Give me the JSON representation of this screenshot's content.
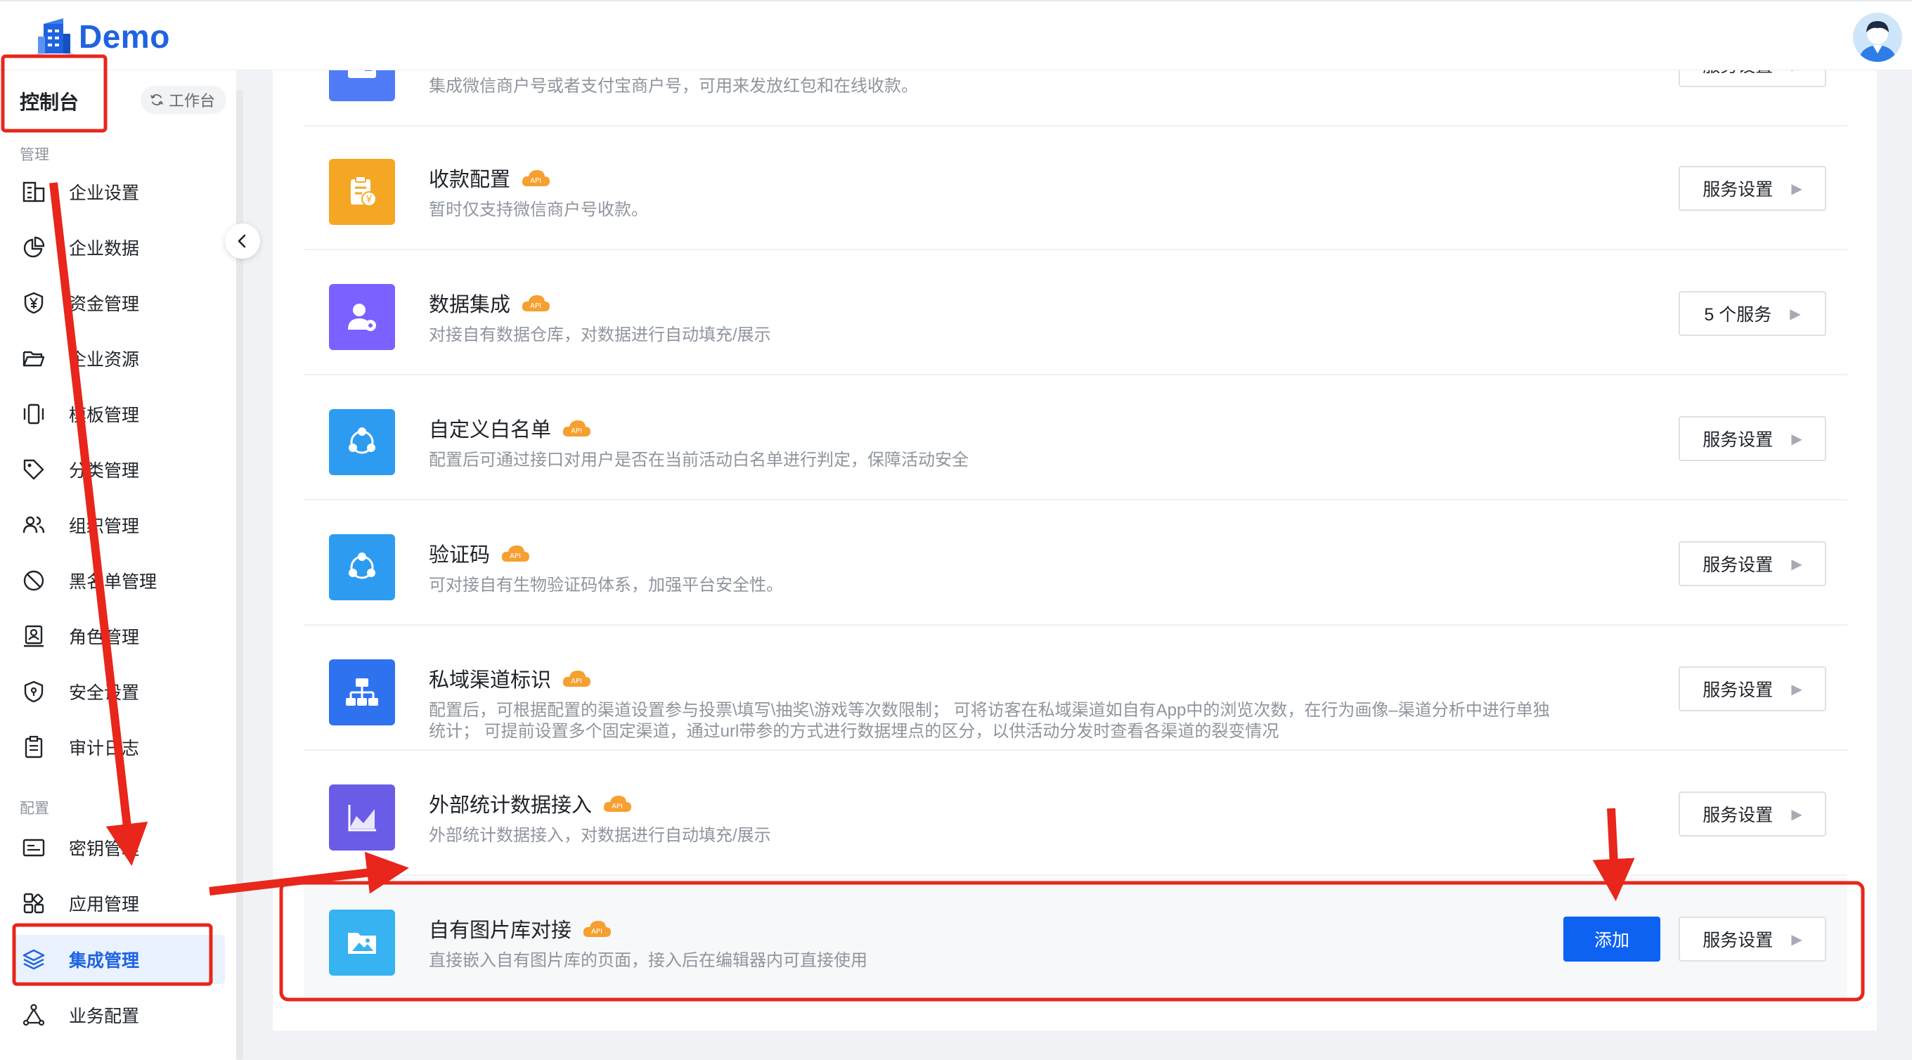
{
  "header": {
    "brand": "Demo"
  },
  "sidebar": {
    "title": "控制台",
    "workbench": "工作台",
    "sections": [
      {
        "label": "管理",
        "items": [
          {
            "label": "企业设置",
            "icon": "building-icon"
          },
          {
            "label": "企业数据",
            "icon": "pie-chart-icon"
          },
          {
            "label": "资金管理",
            "icon": "yen-shield-icon"
          },
          {
            "label": "企业资源",
            "icon": "folder-open-icon"
          },
          {
            "label": "模板管理",
            "icon": "template-icon"
          },
          {
            "label": "分类管理",
            "icon": "tag-icon"
          },
          {
            "label": "组织管理",
            "icon": "users-icon"
          },
          {
            "label": "黑名单管理",
            "icon": "block-icon"
          },
          {
            "label": "角色管理",
            "icon": "role-icon"
          },
          {
            "label": "安全设置",
            "icon": "shield-icon"
          },
          {
            "label": "审计日志",
            "icon": "clipboard-icon"
          }
        ]
      },
      {
        "label": "配置",
        "items": [
          {
            "label": "密钥管理",
            "icon": "key-card-icon"
          },
          {
            "label": "应用管理",
            "icon": "apps-icon"
          },
          {
            "label": "集成管理",
            "icon": "layers-icon",
            "active": true
          },
          {
            "label": "业务配置",
            "icon": "network-icon"
          }
        ]
      }
    ]
  },
  "integrations": [
    {
      "title": "",
      "desc": "集成微信商户号或者支付宝商户号，可用来发放红包和在线收款。",
      "button": "服务设置",
      "tile_color": "#4f7cf6",
      "icon": "payment-icon"
    },
    {
      "title": "收款配置",
      "desc": "暂时仅支持微信商户号收款。",
      "button": "服务设置",
      "tile_color": "#f5a623",
      "icon": "receipt-yen-icon"
    },
    {
      "title": "数据集成",
      "desc": "对接自有数据仓库，对数据进行自动填充/展示",
      "button": "5 个服务",
      "tile_color": "#7b61ff",
      "icon": "user-gear-icon"
    },
    {
      "title": "自定义白名单",
      "desc": "配置后可通过接口对用户是否在当前活动白名单进行判定，保障活动安全",
      "button": "服务设置",
      "tile_color": "#2d9cf0",
      "icon": "share-nodes-icon"
    },
    {
      "title": "验证码",
      "desc": "可对接自有生物验证码体系，加强平台安全性。",
      "button": "服务设置",
      "tile_color": "#2d9cf0",
      "icon": "share-nodes-icon"
    },
    {
      "title": "私域渠道标识",
      "desc": "配置后，可根据配置的渠道设置参与投票\\填写\\抽奖\\游戏等次数限制； 可将访客在私域渠道如自有App中的浏览次数，在行为画像–渠道分析中进行单独统计； 可提前设置多个固定渠道，通过url带参的方式进行数据埋点的区分，以供活动分发时查看各渠道的裂变情况",
      "button": "服务设置",
      "tile_color": "#2f72f0",
      "icon": "org-chart-icon"
    },
    {
      "title": "外部统计数据接入",
      "desc": "外部统计数据接入，对数据进行自动填充/展示",
      "button": "服务设置",
      "tile_color": "#6b5ce7",
      "icon": "line-chart-icon"
    },
    {
      "title": "自有图片库对接",
      "desc": "直接嵌入自有图片库的页面，接入后在编辑器内可直接使用",
      "button": "服务设置",
      "add_label": "添加",
      "tile_color": "#36b3f0",
      "icon": "image-icon"
    }
  ],
  "badge_text": "API",
  "colors": {
    "accent": "#1f63e0",
    "primary_button": "#0d62f2",
    "annotation": "#e8261b",
    "badge": "#f5a030"
  }
}
